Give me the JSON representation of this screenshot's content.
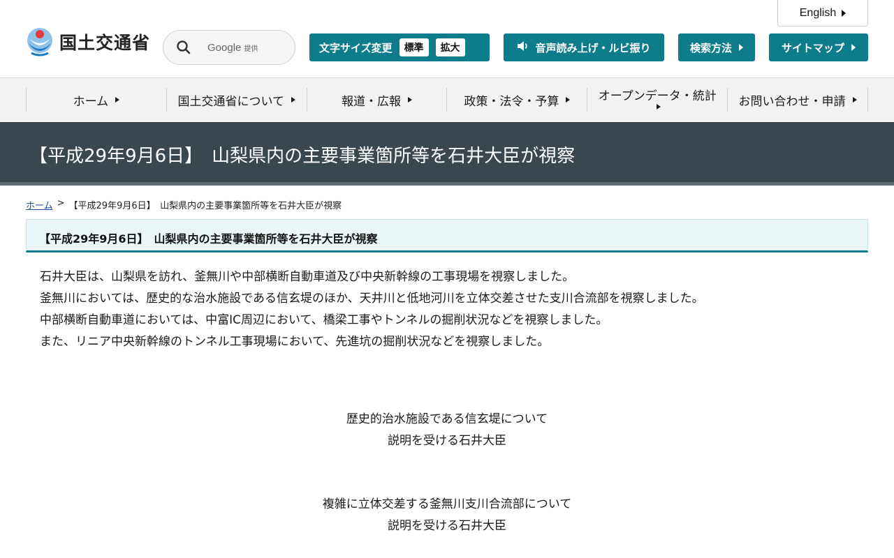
{
  "header": {
    "logo_text": "国土交通省",
    "search": {
      "provider": "Google",
      "provider_sub": "提供"
    },
    "english_label": "English",
    "font_size": {
      "label": "文字サイズ変更",
      "standard": "標準",
      "large": "拡大"
    },
    "voice_label": "音声読み上げ・ルビ振り",
    "search_method_label": "検索方法",
    "sitemap_label": "サイトマップ"
  },
  "nav": {
    "items": [
      {
        "label": "ホーム"
      },
      {
        "label": "国土交通省について"
      },
      {
        "label": "報道・広報"
      },
      {
        "label": "政策・法令・予算"
      },
      {
        "label": "オープンデータ・統計"
      },
      {
        "label": "お問い合わせ・申請"
      }
    ]
  },
  "page": {
    "title": "【平成29年9月6日】　山梨県内の主要事業箇所等を石井大臣が視察",
    "breadcrumb": {
      "home": "ホーム",
      "separator": ">",
      "current": "【平成29年9月6日】　山梨県内の主要事業箇所等を石井大臣が視察"
    },
    "section_heading": "【平成29年9月6日】　山梨県内の主要事業箇所等を石井大臣が視察",
    "paragraphs": [
      "石井大臣は、山梨県を訪れ、釜無川や中部横断自動車道及び中央新幹線の工事現場を視察しました。",
      "釜無川においては、歴史的な治水施設である信玄堤のほか、天井川と低地河川を立体交差させた支川合流部を視察しました。",
      "中部横断自動車道においては、中富IC周辺において、橋梁工事やトンネルの掘削状況などを視察しました。",
      "また、リニア中央新幹線のトンネル工事現場において、先進坑の掘削状況などを視察しました。"
    ],
    "captions": [
      {
        "line1": "歴史的治水施設である信玄堤について",
        "line2": "説明を受ける石井大臣"
      },
      {
        "line1": "複雑に立体交差する釜無川支川合流部について",
        "line2": "説明を受ける石井大臣"
      }
    ]
  },
  "colors": {
    "accent_teal": "#0e7c8b",
    "title_band": "#3b474f",
    "nav_background": "#f2f2f2",
    "link": "#1a4fa0"
  }
}
